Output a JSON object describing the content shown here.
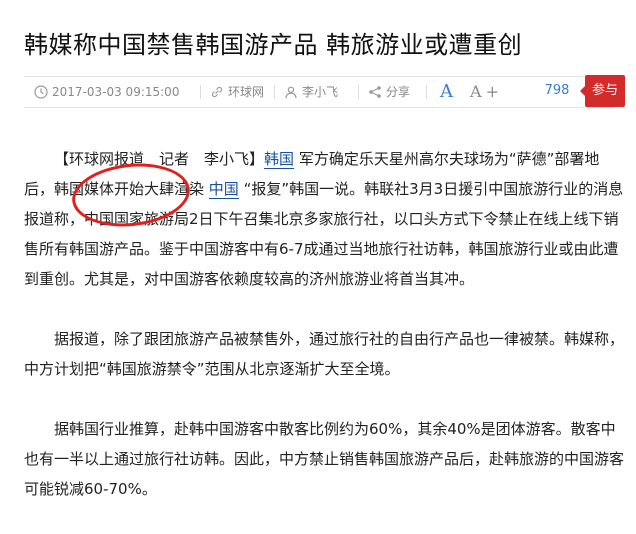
{
  "article": {
    "title": "韩媒称中国禁售韩国游产品 韩旅游业或遭重创",
    "meta": {
      "datetime": "2017-03-03 09:15:00",
      "source": "环球网",
      "author": "李小飞",
      "share_label": "分享",
      "font_increase_label": "A",
      "font_decrease_label": "A",
      "comment_count": "798",
      "comment_button_label": "参与"
    },
    "paragraphs": [
      {
        "prefix": "【环球网报道　记者　李小飞】",
        "link1": "韩国",
        "mid1": "军方确定乐天星州高尔夫球场为“萨德”部署地后，韩国媒体开始大肆渲染",
        "link2": "中国",
        "rest": "“报复”韩国一说。韩联社3月3日援引中国旅游行业的消息报道称，中国国家旅游局2日下午召集北京多家旅行社，以口头方式下令禁止在线上线下销售所有韩国游产品。鉴于中国游客中有6-7成通过当地旅行社访韩，韩国旅游行业或由此遭到重创。尤其是，对中国游客依赖度较高的济州旅游业将首当其冲。"
      },
      {
        "text": "据报道，除了跟团旅游产品被禁售外，通过旅行社的自由行产品也一律被禁。韩媒称，中方计划把“韩国旅游禁令”范围从北京逐渐扩大至全境。"
      },
      {
        "text": "据韩国行业推算，赴韩中国游客中散客比例约为60%，其余40%是团体游客。散客中也有一半以上通过旅行社访韩。因此，中方禁止销售韩国旅游产品后，赴韩旅游的中国游客可能锐减60-70%。"
      }
    ]
  },
  "colors": {
    "accent_blue": "#3a7bd5",
    "comment_red": "#d32a2a",
    "annotation_red": "#e0201e"
  },
  "icons": [
    "clock-icon",
    "link-icon",
    "user-icon",
    "share-icon"
  ]
}
